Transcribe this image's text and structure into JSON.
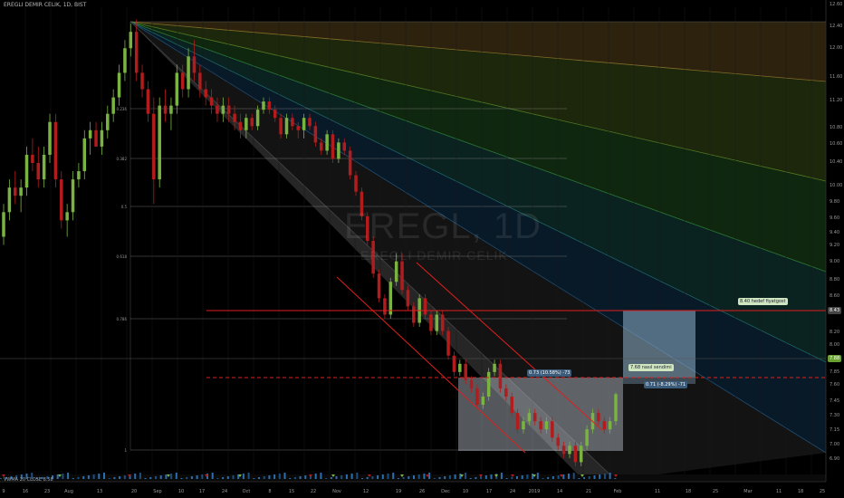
{
  "header": {
    "title": "EREGLI DEMIR CELIK, 1D, BIST"
  },
  "watermark": {
    "symbol": "EREGL, 1D",
    "name": "EREGLI DEMIR CELIK"
  },
  "annotations": {
    "target_note": "8.40 hedef fiyatgost",
    "entry_note": "7.68 nasıl sendimi",
    "entry_stats": "0.73 (10.58%) -73",
    "stop_stats": "0.71 (-8.29%) -71",
    "price_tag": "8.43",
    "last_tag": "7.88",
    "volume_label": "VWMA 20 CLOSE 8.58"
  },
  "colors": {
    "up": "#7ab341",
    "down": "#b31c1c",
    "resistance": "#e01e1e",
    "target_box": "#8fb3cc",
    "stop_box": "#c7d1dc",
    "fan_1": "#8a6a2a",
    "fan_2": "#5a7a22",
    "fan_3": "#2f7a2f",
    "fan_4": "#1f6a63",
    "fan_5": "#1a4f7a",
    "fan_6": "#3a3a3a"
  },
  "chart_data": {
    "type": "candlestick",
    "symbol": "EREGL",
    "interval": "1D",
    "ylim": [
      6.9,
      12.6
    ],
    "y_ticks": [
      "12.60",
      "12.40",
      "12.00",
      "11.60",
      "11.20",
      "10.80",
      "10.60",
      "10.40",
      "10.00",
      "9.80",
      "9.60",
      "9.40",
      "9.20",
      "9.00",
      "8.80",
      "8.60",
      "8.40",
      "8.20",
      "8.00",
      "7.85",
      "7.60",
      "7.45",
      "7.30",
      "7.15",
      "7.00",
      "6.90"
    ],
    "x_ticks": [
      "",
      "9",
      "16",
      "23",
      "Aug",
      "13",
      "20",
      "Sep",
      "10",
      "17",
      "24",
      "Oct",
      "8",
      "15",
      "22",
      "Nov",
      "12",
      "19",
      "26",
      "Dec",
      "10",
      "17",
      "24",
      "2019",
      "14",
      "21",
      "Feb",
      "11",
      "18",
      "25",
      "Mar",
      "11",
      "18",
      "25"
    ],
    "fib_levels": [
      "0.236",
      "0.382",
      "0.5",
      "0.618",
      "0.786",
      "1"
    ],
    "fan_levels": [
      "0.236",
      "0.382",
      "0.5",
      "0.618",
      "0.786"
    ],
    "resistance_level": 8.43,
    "target_level": 7.68,
    "candles": [
      [
        9.8,
        10.2,
        9.7,
        10.1
      ],
      [
        10.1,
        10.5,
        10.0,
        10.4
      ],
      [
        10.4,
        10.6,
        10.2,
        10.3
      ],
      [
        10.3,
        10.5,
        10.1,
        10.4
      ],
      [
        10.4,
        10.9,
        10.3,
        10.8
      ],
      [
        10.8,
        11.0,
        10.6,
        10.7
      ],
      [
        10.7,
        10.9,
        10.4,
        10.5
      ],
      [
        10.5,
        10.9,
        10.4,
        10.8
      ],
      [
        10.8,
        11.3,
        10.7,
        11.2
      ],
      [
        11.2,
        11.3,
        10.4,
        10.5
      ],
      [
        10.5,
        10.6,
        9.9,
        10.0
      ],
      [
        10.0,
        10.2,
        9.8,
        10.1
      ],
      [
        10.1,
        10.6,
        10.0,
        10.5
      ],
      [
        10.5,
        10.7,
        10.4,
        10.6
      ],
      [
        10.6,
        11.1,
        10.5,
        11.0
      ],
      [
        11.0,
        11.2,
        10.8,
        11.1
      ],
      [
        11.1,
        11.2,
        10.9,
        10.9
      ],
      [
        10.9,
        11.2,
        10.8,
        11.1
      ],
      [
        11.1,
        11.4,
        11.0,
        11.3
      ],
      [
        11.3,
        11.6,
        11.2,
        11.5
      ],
      [
        11.5,
        11.9,
        11.4,
        11.8
      ],
      [
        11.8,
        12.2,
        11.7,
        12.1
      ],
      [
        12.1,
        12.4,
        12.0,
        12.3
      ],
      [
        12.3,
        12.45,
        11.7,
        11.8
      ],
      [
        11.8,
        11.9,
        11.5,
        11.6
      ],
      [
        11.6,
        11.7,
        11.2,
        11.3
      ],
      [
        11.3,
        11.5,
        10.2,
        10.5
      ],
      [
        10.5,
        11.5,
        10.4,
        11.4
      ],
      [
        11.4,
        11.6,
        11.2,
        11.3
      ],
      [
        11.3,
        11.5,
        11.1,
        11.4
      ],
      [
        11.4,
        11.9,
        11.3,
        11.8
      ],
      [
        11.8,
        11.9,
        11.5,
        11.6
      ],
      [
        11.6,
        12.1,
        11.5,
        12.0
      ],
      [
        12.0,
        12.2,
        11.7,
        11.8
      ],
      [
        11.8,
        11.9,
        11.5,
        11.6
      ],
      [
        11.6,
        11.7,
        11.4,
        11.5
      ],
      [
        11.5,
        11.6,
        11.3,
        11.4
      ],
      [
        11.4,
        11.5,
        11.2,
        11.3
      ],
      [
        11.3,
        11.5,
        11.2,
        11.4
      ],
      [
        11.4,
        11.5,
        11.2,
        11.3
      ],
      [
        11.3,
        11.4,
        11.1,
        11.2
      ],
      [
        11.2,
        11.3,
        11.0,
        11.1
      ],
      [
        11.1,
        11.3,
        11.0,
        11.25
      ],
      [
        11.25,
        11.3,
        11.1,
        11.15
      ],
      [
        11.15,
        11.4,
        11.1,
        11.35
      ],
      [
        11.35,
        11.5,
        11.3,
        11.45
      ],
      [
        11.45,
        11.5,
        11.3,
        11.35
      ],
      [
        11.35,
        11.4,
        11.2,
        11.25
      ],
      [
        11.25,
        11.3,
        11.0,
        11.05
      ],
      [
        11.05,
        11.3,
        11.0,
        11.25
      ],
      [
        11.25,
        11.3,
        11.1,
        11.15
      ],
      [
        11.15,
        11.2,
        11.0,
        11.1
      ],
      [
        11.1,
        11.3,
        11.0,
        11.25
      ],
      [
        11.25,
        11.3,
        11.1,
        11.15
      ],
      [
        11.15,
        11.2,
        10.9,
        10.95
      ],
      [
        10.95,
        11.0,
        10.8,
        10.85
      ],
      [
        10.85,
        11.1,
        10.8,
        11.05
      ],
      [
        11.05,
        11.1,
        10.7,
        10.75
      ],
      [
        10.75,
        11.0,
        10.7,
        10.95
      ],
      [
        10.95,
        11.0,
        10.8,
        10.85
      ],
      [
        10.85,
        10.9,
        10.5,
        10.55
      ],
      [
        10.55,
        10.6,
        10.3,
        10.35
      ],
      [
        10.35,
        10.4,
        10.0,
        10.05
      ],
      [
        10.05,
        10.1,
        9.7,
        9.75
      ],
      [
        9.75,
        9.8,
        9.3,
        9.35
      ],
      [
        9.35,
        9.4,
        9.0,
        9.05
      ],
      [
        9.05,
        9.1,
        8.8,
        8.85
      ],
      [
        8.85,
        9.3,
        8.8,
        9.25
      ],
      [
        9.25,
        9.6,
        9.2,
        9.5
      ],
      [
        9.5,
        9.6,
        9.1,
        9.15
      ],
      [
        9.15,
        9.2,
        8.9,
        8.95
      ],
      [
        8.95,
        9.0,
        8.7,
        8.75
      ],
      [
        8.75,
        9.1,
        8.7,
        9.05
      ],
      [
        9.05,
        9.1,
        8.8,
        8.85
      ],
      [
        8.85,
        8.9,
        8.6,
        8.65
      ],
      [
        8.65,
        8.9,
        8.6,
        8.85
      ],
      [
        8.85,
        8.9,
        8.6,
        8.65
      ],
      [
        8.65,
        8.7,
        8.3,
        8.35
      ],
      [
        8.35,
        8.4,
        8.1,
        8.15
      ],
      [
        8.15,
        8.3,
        8.1,
        8.25
      ],
      [
        8.25,
        8.3,
        8.0,
        8.05
      ],
      [
        8.05,
        8.1,
        7.9,
        7.95
      ],
      [
        7.95,
        8.0,
        7.7,
        7.75
      ],
      [
        7.75,
        7.9,
        7.7,
        7.85
      ],
      [
        7.85,
        8.2,
        7.8,
        8.15
      ],
      [
        8.15,
        8.3,
        8.1,
        8.25
      ],
      [
        8.25,
        8.3,
        7.9,
        7.95
      ],
      [
        7.95,
        8.0,
        7.8,
        7.85
      ],
      [
        7.85,
        7.9,
        7.6,
        7.65
      ],
      [
        7.65,
        7.7,
        7.4,
        7.45
      ],
      [
        7.45,
        7.6,
        7.4,
        7.55
      ],
      [
        7.55,
        7.7,
        7.5,
        7.65
      ],
      [
        7.65,
        7.7,
        7.5,
        7.55
      ],
      [
        7.55,
        7.6,
        7.4,
        7.45
      ],
      [
        7.45,
        7.6,
        7.4,
        7.55
      ],
      [
        7.55,
        7.6,
        7.3,
        7.35
      ],
      [
        7.35,
        7.4,
        7.2,
        7.25
      ],
      [
        7.25,
        7.3,
        7.1,
        7.15
      ],
      [
        7.15,
        7.3,
        7.1,
        7.25
      ],
      [
        7.25,
        7.3,
        7.0,
        7.05
      ],
      [
        7.05,
        7.3,
        7.0,
        7.25
      ],
      [
        7.25,
        7.5,
        7.2,
        7.45
      ],
      [
        7.45,
        7.7,
        7.4,
        7.65
      ],
      [
        7.65,
        7.7,
        7.5,
        7.55
      ],
      [
        7.55,
        7.6,
        7.4,
        7.45
      ],
      [
        7.45,
        7.6,
        7.4,
        7.55
      ],
      [
        7.55,
        7.9,
        7.5,
        7.88
      ]
    ]
  }
}
